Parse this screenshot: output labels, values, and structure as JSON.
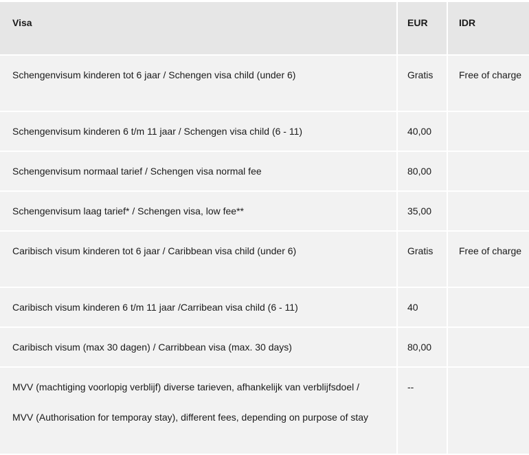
{
  "table": {
    "headers": {
      "visa": "Visa",
      "eur": "EUR",
      "idr": "IDR"
    },
    "rows": [
      {
        "visa": "Schengenvisum kinderen tot 6 jaar / Schengen visa child (under 6)",
        "eur": "Gratis",
        "idr": "Free of charge"
      },
      {
        "visa": "Schengenvisum kinderen 6 t/m 11 jaar / Schengen visa child (6 - 11)",
        "eur": "40,00",
        "idr": ""
      },
      {
        "visa": "Schengenvisum normaal tarief / Schengen visa normal fee",
        "eur": "80,00",
        "idr": ""
      },
      {
        "visa": "Schengenvisum laag tarief* / Schengen visa, low fee**",
        "eur": "35,00",
        "idr": ""
      },
      {
        "visa": "Caribisch visum kinderen tot 6 jaar / Caribbean visa child (under 6)",
        "eur": "Gratis",
        "idr": "Free of charge"
      },
      {
        "visa": "Caribisch visum kinderen 6 t/m 11 jaar /Carribean visa child (6 - 11)",
        "eur": "40",
        "idr": ""
      },
      {
        "visa": "Caribisch visum (max 30 dagen) / Carribbean visa (max. 30  days)",
        "eur": "80,00",
        "idr": ""
      },
      {
        "visa_line1": "MVV (machtiging voorlopig verblijf) diverse tarieven, afhankelijk van verblijfsdoel /",
        "visa_line2": "MVV (Authorisation for temporay stay), different fees, depending on purpose of stay",
        "eur": "--",
        "idr": ""
      }
    ]
  },
  "colors": {
    "header_bg": "#e6e6e6",
    "row_bg": "#f2f2f2",
    "grid_line": "#ffffff",
    "text": "#1a1a1a"
  }
}
